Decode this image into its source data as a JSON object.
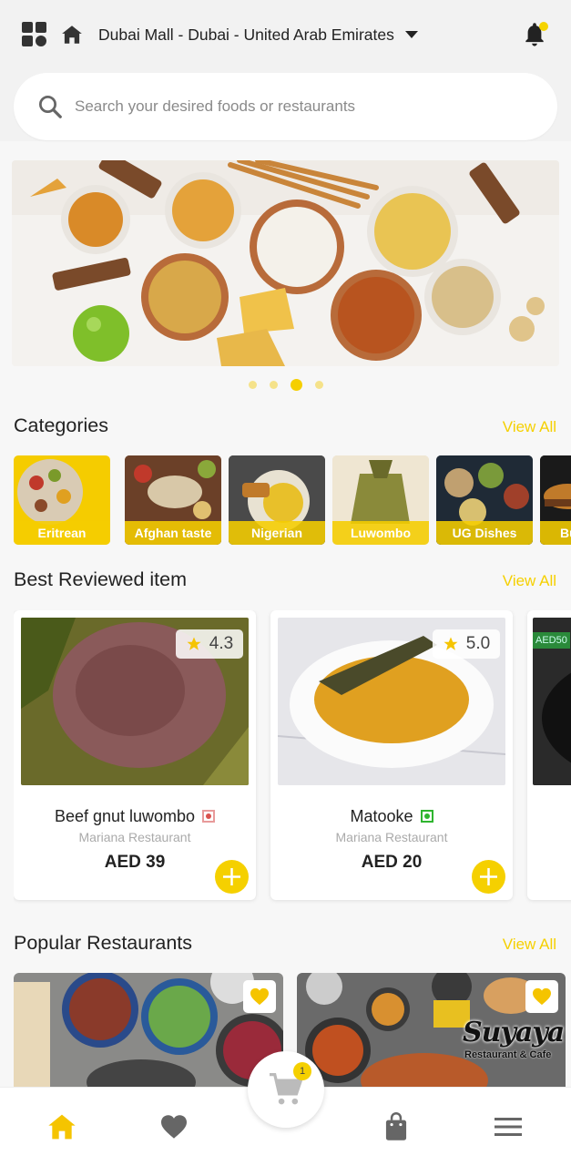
{
  "header": {
    "location": "Dubai Mall - Dubai - United Arab Emirates",
    "search_placeholder": "Search your desired foods or restaurants"
  },
  "banner": {
    "slide_count": 4,
    "active_slide": 3
  },
  "categories": {
    "title": "Categories",
    "view_all": "View All",
    "items": [
      {
        "label": "Eritrean"
      },
      {
        "label": "Afghan taste"
      },
      {
        "label": "Nigerian"
      },
      {
        "label": "Luwombo"
      },
      {
        "label": "UG Dishes"
      },
      {
        "label": "Bu"
      }
    ]
  },
  "best_reviewed": {
    "title": "Best Reviewed item",
    "view_all": "View All",
    "items": [
      {
        "name": "Beef gnut luwombo",
        "restaurant": "Mariana Restaurant",
        "price": "AED 39",
        "rating": "4.3",
        "diet": "non-veg"
      },
      {
        "name": "Matooke",
        "restaurant": "Mariana Restaurant",
        "price": "AED 20",
        "rating": "5.0",
        "diet": "veg"
      }
    ],
    "partial_badge": "AED50"
  },
  "popular": {
    "title": "Popular Restaurants",
    "view_all": "View All",
    "items": [
      {
        "logo": ""
      },
      {
        "logo": "Suyaya",
        "logo_sub": "Restaurant & Cafe"
      }
    ]
  },
  "cart": {
    "count": "1"
  },
  "colors": {
    "accent": "#f5d000",
    "veg": "#2fb52f",
    "nonveg": "#d9534f"
  },
  "icons": [
    "grid-icon",
    "home-icon",
    "bell-icon",
    "search-icon",
    "star-icon",
    "plus-icon",
    "heart-icon",
    "cart-icon",
    "bag-icon",
    "menu-icon"
  ]
}
